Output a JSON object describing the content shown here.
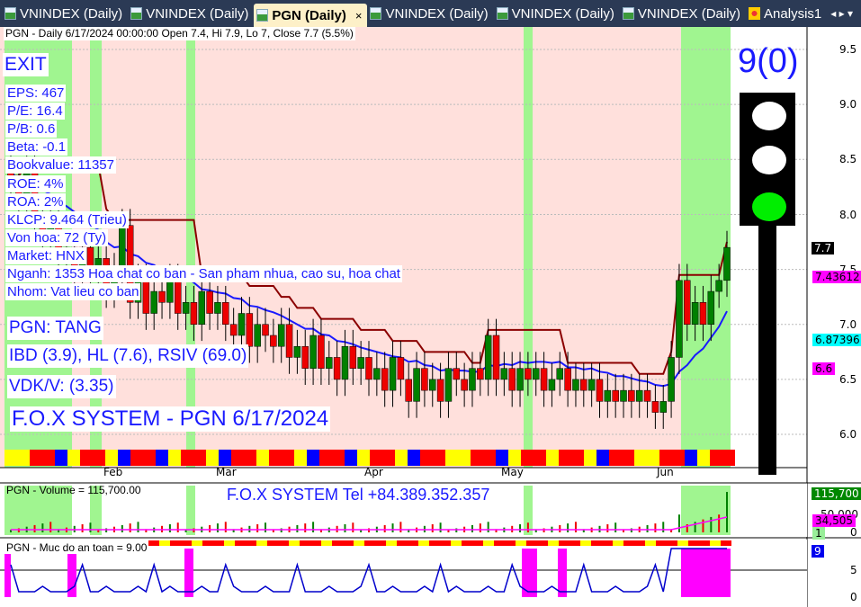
{
  "tabs": [
    {
      "label": "VNINDEX (Daily)"
    },
    {
      "label": "VNINDEX (Daily)"
    },
    {
      "label": "PGN (Daily)",
      "active": true
    },
    {
      "label": "VNINDEX (Daily)"
    },
    {
      "label": "VNINDEX (Daily)"
    },
    {
      "label": "VNINDEX (Daily)"
    },
    {
      "label": "Analysis1"
    }
  ],
  "header": "PGN - Daily 6/17/2024 00:00:00 Open 7.4, Hi 7.9, Lo 7, Close 7.7 (5.5%)",
  "signal": "EXIT",
  "fundamentals": [
    "EPS: 467",
    "P/E: 16.4",
    "P/B: 0.6",
    "Beta: -0.1",
    "Bookvalue: 11357",
    "ROE: 4%",
    "ROA: 2%",
    "KLCP: 9.464 (Trieu)",
    "Von hoa: 72 (Ty)",
    "Market: HNX",
    "Nganh: 1353 Hoa chat co ban - San pham nhua, cao su, hoa chat",
    "Nhom: Vat lieu co ban"
  ],
  "status": "PGN: TANG",
  "ratings": "IBD (3.9), HL (7.6), RSIV (69.0)",
  "vdk": "VDK/V:  (3.35)",
  "system_title": "F.O.X SYSTEM - PGN 6/17/2024",
  "score": "9(0)",
  "traffic_light": {
    "top": "#ffffff",
    "middle": "#ffffff",
    "bottom": "#00ee00"
  },
  "price_axis": [
    "9.5",
    "9.0",
    "8.5",
    "8.0",
    "7.5",
    "7.0",
    "6.5",
    "6.0"
  ],
  "price_tags": {
    "close": "7.7",
    "ma1": "7.43612",
    "ma2": "6.87396",
    "ma3": "6.6"
  },
  "months": [
    "Feb",
    "Mar",
    "Apr",
    "May",
    "Jun"
  ],
  "volume_pane": {
    "title": "PGN - Volume = 115,700.00",
    "contact": "F.O.X SYSTEM Tel +84.389.352.357",
    "axis": [
      "50,000",
      "0"
    ],
    "tags": {
      "volume": "115,700",
      "avg": "34,505",
      "flag": "1"
    }
  },
  "safety_pane": {
    "title": "PGN - Muc do an toan = 9.00",
    "axis": [
      "5",
      "0"
    ],
    "tag": "9"
  },
  "chart_data": {
    "type": "candlestick",
    "ylim": [
      5.7,
      9.7
    ],
    "closes": [
      8.3,
      8.1,
      8.4,
      8.0,
      7.8,
      7.9,
      7.6,
      7.7,
      7.5,
      7.7,
      7.4,
      7.6,
      7.3,
      7.5,
      7.9,
      7.2,
      7.4,
      7.1,
      7.3,
      7.2,
      7.4,
      7.1,
      7.2,
      7.0,
      7.3,
      7.1,
      7.2,
      7.0,
      6.9,
      7.1,
      6.8,
      7.0,
      6.9,
      6.8,
      7.0,
      6.7,
      6.8,
      6.6,
      6.9,
      6.6,
      6.7,
      6.5,
      6.8,
      6.6,
      6.7,
      6.5,
      6.6,
      6.4,
      6.7,
      6.5,
      6.3,
      6.6,
      6.4,
      6.5,
      6.3,
      6.6,
      6.5,
      6.4,
      6.6,
      6.5,
      6.9,
      6.5,
      6.6,
      6.4,
      6.6,
      6.5,
      6.6,
      6.4,
      6.5,
      6.6,
      6.4,
      6.5,
      6.4,
      6.5,
      6.3,
      6.4,
      6.3,
      6.4,
      6.3,
      6.4,
      6.3,
      6.2,
      6.3,
      6.7,
      7.4,
      7.0,
      7.2,
      7.0,
      7.3,
      7.4,
      7.7
    ]
  }
}
